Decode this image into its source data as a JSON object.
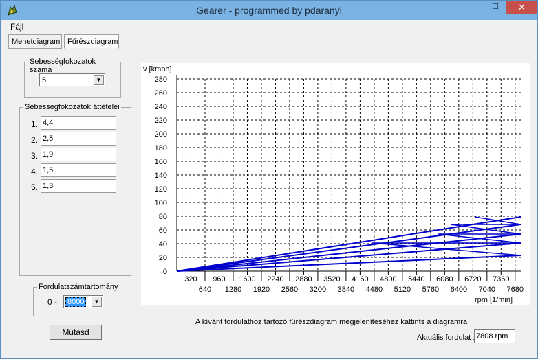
{
  "window": {
    "title": "Gearer - programmed by pdaranyi",
    "close_label": "✕",
    "max_label": "□",
    "min_label": "—"
  },
  "menu": {
    "file_label": "Fájl"
  },
  "tabs": [
    {
      "label": "Menetdiagram",
      "active": false
    },
    {
      "label": "Fűrészdiagram",
      "active": true
    }
  ],
  "gear_count": {
    "title": "Sebességfokozatok száma",
    "value": "5"
  },
  "gear_ratios": {
    "title": "Sebességfokozatok áttételei",
    "items": [
      {
        "label": "1.",
        "value": "4,4"
      },
      {
        "label": "2.",
        "value": "2,5"
      },
      {
        "label": "3.",
        "value": "1,9"
      },
      {
        "label": "4.",
        "value": "1,5"
      },
      {
        "label": "5.",
        "value": "1,3"
      }
    ]
  },
  "rpm_range": {
    "title": "Fordulatszámtartomány",
    "from_label": "0 -",
    "value": "8000"
  },
  "show_button": "Mutasd",
  "hint_text": "A kívánt fordulathoz tartozó fűrészdiagram megjelenítéséhez kattints a diagramra",
  "current_rpm": {
    "label": "Aktuális fordulat :",
    "value": "7808 rpm"
  },
  "colors": {
    "series": "#0000cc",
    "titlebar": "#7ab3e3",
    "close": "#c7504a"
  },
  "chart_data": {
    "type": "line",
    "ylabel": "v [kmph]",
    "xlabel": "rpm [1/min]",
    "ylim": [
      0,
      280
    ],
    "xlim": [
      0,
      7808
    ],
    "grid": true,
    "y_ticks": [
      "280",
      "260",
      "240",
      "220",
      "200",
      "180",
      "160",
      "140",
      "120",
      "100",
      "80",
      "60",
      "40",
      "20",
      "0"
    ],
    "x_ticks_upper": [
      "320",
      "960",
      "1600",
      "2240",
      "2880",
      "3520",
      "4160",
      "4800",
      "5440",
      "6080",
      "6720",
      "7360"
    ],
    "x_ticks_lower": [
      "640",
      "1280",
      "1920",
      "2560",
      "3200",
      "3840",
      "4480",
      "5120",
      "5760",
      "6400",
      "7040",
      "7680"
    ],
    "series": [
      {
        "values": [
          [
            0,
            0
          ],
          [
            7808,
            23
          ]
        ]
      },
      {
        "values": [
          [
            0,
            0
          ],
          [
            7808,
            41
          ]
        ]
      },
      {
        "values": [
          [
            0,
            0
          ],
          [
            7808,
            54
          ]
        ]
      },
      {
        "values": [
          [
            0,
            0
          ],
          [
            7808,
            68
          ]
        ]
      },
      {
        "values": [
          [
            0,
            0
          ],
          [
            7808,
            79
          ]
        ]
      }
    ],
    "sawtooth": [
      [
        7808,
        23
      ],
      [
        4437,
        41
      ],
      [
        7808,
        41
      ],
      [
        5936,
        54
      ],
      [
        7808,
        54
      ],
      [
        6216,
        68
      ],
      [
        7808,
        68
      ],
      [
        6768,
        79
      ]
    ]
  }
}
